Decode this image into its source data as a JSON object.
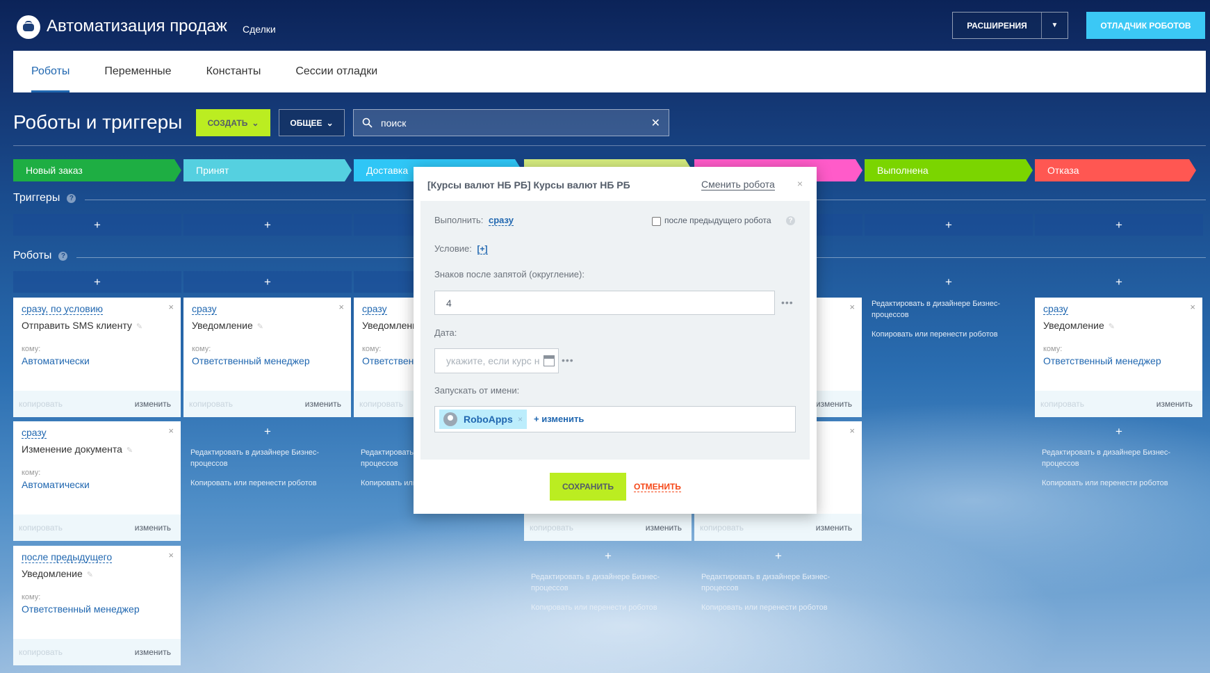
{
  "header": {
    "app_title": "Автоматизация продаж",
    "app_sub": "Сделки",
    "extensions_label": "РАСШИРЕНИЯ",
    "debugger_label": "ОТЛАДЧИК РОБОТОВ"
  },
  "tabs": [
    {
      "label": "Роботы",
      "active": true
    },
    {
      "label": "Переменные"
    },
    {
      "label": "Константы"
    },
    {
      "label": "Сессии отладки"
    }
  ],
  "toolbar": {
    "page_title": "Роботы и триггеры",
    "create_label": "СОЗДАТЬ",
    "general_label": "ОБЩЕЕ",
    "search_text": "поиск"
  },
  "stages": [
    {
      "label": "Новый заказ",
      "color": "#1eae43"
    },
    {
      "label": "Принят",
      "color": "#55d0e0"
    },
    {
      "label": "Доставка",
      "color": "#2fc6f6"
    },
    {
      "label": "",
      "color": "#d5ec7f"
    },
    {
      "label": "",
      "color": "#ff5bc9"
    },
    {
      "label": "Выполнена",
      "color": "#7bd500"
    },
    {
      "label": "Отказа",
      "color": "#ff5752"
    }
  ],
  "sections": {
    "triggers": "Триггеры",
    "robots": "Роботы"
  },
  "plus": "+",
  "card_common": {
    "to_label": "кому:",
    "copy": "копировать",
    "edit": "изменить",
    "close": "×"
  },
  "cards": [
    {
      "when": "сразу, по условию",
      "name": "Отправить SMS клиенту",
      "to": "Автоматически"
    },
    {
      "when": "сразу",
      "name": "Изменение документа",
      "to": "Автоматически"
    },
    {
      "when": "после предыдущего",
      "name": "Уведомление",
      "to": "Ответственный менеджер"
    },
    {
      "when": "сразу",
      "name": "Уведомление",
      "to": "Ответственный менеджер"
    },
    {
      "when": "сразу",
      "name": "Уведомлени",
      "to": "Ответствен"
    },
    {
      "when": "сразу",
      "name": "Уведомление",
      "to": "Ответственный менеджер"
    }
  ],
  "designer": {
    "edit_in_designer_1": "Редактировать в дизайнере Бизнес-",
    "edit_in_designer_2": "процессов",
    "copy_move": "Копировать или перенести роботов"
  },
  "modal": {
    "title": "[Курсы валют НБ РБ] Курсы валют НБ РБ",
    "change_robot": "Сменить робота",
    "close": "×",
    "run_label": "Выполнить:",
    "run_value": "сразу",
    "after_prev": "после предыдущего робота",
    "condition_label": "Условие:",
    "condition_value": "[+]",
    "decimals_label": "Знаков после запятой (округление):",
    "decimals_value": "4",
    "date_label": "Дата:",
    "date_placeholder": "укажите, если курс н",
    "run_as_label": "Запускать от имени:",
    "run_as_user": "RoboApps",
    "change_link": "+ изменить",
    "dots": "•••",
    "save": "СОХРАНИТЬ",
    "cancel": "ОТМЕНИТЬ"
  }
}
